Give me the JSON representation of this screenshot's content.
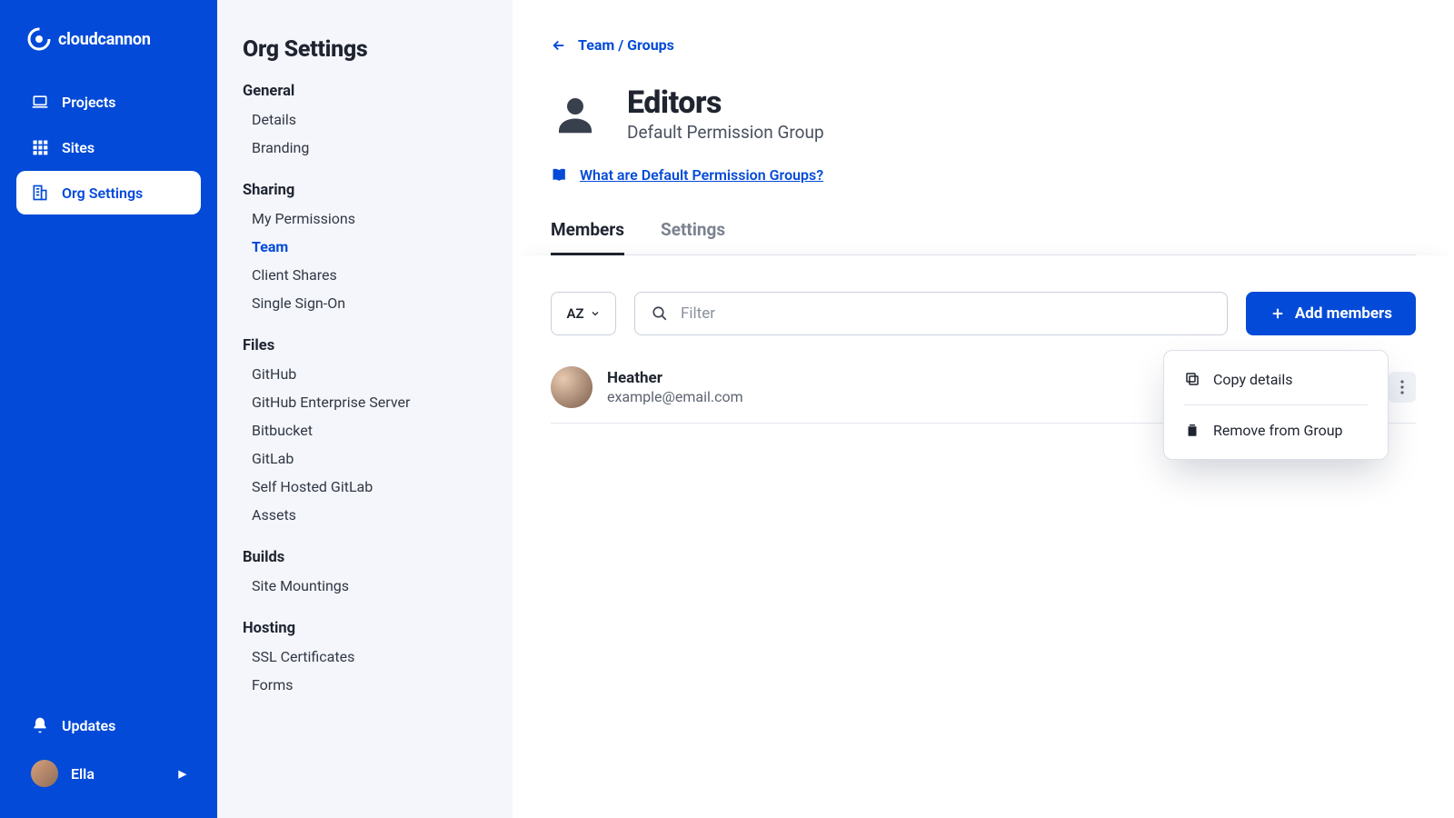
{
  "brand": "cloudcannon",
  "nav": {
    "projects": "Projects",
    "sites": "Sites",
    "org_settings": "Org Settings"
  },
  "footer": {
    "updates": "Updates",
    "user": "Ella"
  },
  "secondary": {
    "title": "Org Settings",
    "groups": {
      "general": {
        "label": "General",
        "items": {
          "details": "Details",
          "branding": "Branding"
        }
      },
      "sharing": {
        "label": "Sharing",
        "items": {
          "my_permissions": "My Permissions",
          "team": "Team",
          "client_shares": "Client Shares",
          "sso": "Single Sign-On"
        }
      },
      "files": {
        "label": "Files",
        "items": {
          "github": "GitHub",
          "ghes": "GitHub Enterprise Server",
          "bitbucket": "Bitbucket",
          "gitlab": "GitLab",
          "self_gitlab": "Self Hosted GitLab",
          "assets": "Assets"
        }
      },
      "builds": {
        "label": "Builds",
        "items": {
          "site_mountings": "Site Mountings"
        }
      },
      "hosting": {
        "label": "Hosting",
        "items": {
          "ssl": "SSL Certificates",
          "forms": "Forms"
        }
      }
    }
  },
  "breadcrumb": "Team / Groups",
  "group": {
    "title": "Editors",
    "subtitle": "Default Permission Group"
  },
  "info_link": "What are Default Permission Groups?",
  "tabs": {
    "members": "Members",
    "settings": "Settings"
  },
  "toolbar": {
    "sort": "AZ",
    "filter_placeholder": "Filter",
    "add": "Add members"
  },
  "member": {
    "name": "Heather",
    "email": "example@email.com"
  },
  "menu": {
    "copy": "Copy details",
    "remove": "Remove from Group"
  }
}
